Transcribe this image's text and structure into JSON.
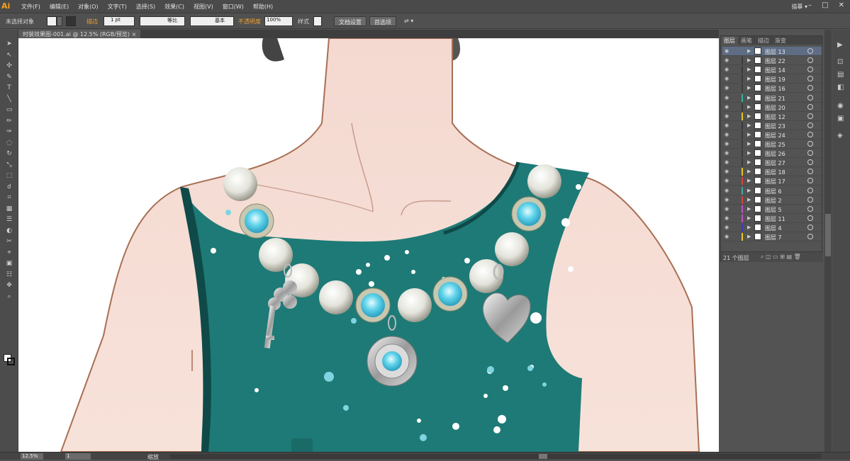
{
  "app": {
    "logo": "Ai",
    "workspace": "描摹 ▾"
  },
  "menu": [
    "文件(F)",
    "编辑(E)",
    "对象(O)",
    "文字(T)",
    "选择(S)",
    "效果(C)",
    "视图(V)",
    "窗口(W)",
    "帮助(H)"
  ],
  "control": {
    "selection": "未选择对象",
    "stroke_label": "描边",
    "stroke_weight": "1 pt",
    "profile": "等比",
    "brush": "基本",
    "opacity_label": "不透明度",
    "opacity_value": "100%",
    "style_label": "样式",
    "doc_setup": "文档设置",
    "prefs": "首选项"
  },
  "document": {
    "tab": "时装效果图-001.ai @ 12.5% (RGB/预览)"
  },
  "layers": {
    "tabs": [
      "图层",
      "画笔",
      "描边",
      "渐变"
    ],
    "rows": [
      {
        "name": "图层 13",
        "color": "#5e6d84",
        "selected": true
      },
      {
        "name": "图层 22",
        "color": "#3a3a3a"
      },
      {
        "name": "图层 14",
        "color": "#3a3a3a"
      },
      {
        "name": "图层 19",
        "color": "#3a3a3a"
      },
      {
        "name": "图层 16",
        "color": "#3a3a3a"
      },
      {
        "name": "图层 21",
        "color": "#2fb3a6"
      },
      {
        "name": "图层 20",
        "color": "#3a3a3a"
      },
      {
        "name": "图层 12",
        "color": "#e5c520"
      },
      {
        "name": "图层 23",
        "color": "#3a3a3a"
      },
      {
        "name": "图层 24",
        "color": "#3a3a3a"
      },
      {
        "name": "图层 25",
        "color": "#3a3a3a"
      },
      {
        "name": "图层 26",
        "color": "#3a3a3a"
      },
      {
        "name": "图层 27",
        "color": "#3a3a3a"
      },
      {
        "name": "图层 18",
        "color": "#e5c520"
      },
      {
        "name": "图层 17",
        "color": "#d94040"
      },
      {
        "name": "图层 6",
        "color": "#4aa3b0"
      },
      {
        "name": "图层 2",
        "color": "#d94040"
      },
      {
        "name": "图层 5",
        "color": "#c050c0"
      },
      {
        "name": "图层 11",
        "color": "#c050c0"
      },
      {
        "name": "图层 4",
        "color": "#3a3abf"
      },
      {
        "name": "图层 7",
        "color": "#e5c520"
      }
    ],
    "count": "21 个图层"
  },
  "status": {
    "zoom": "12.5%",
    "page": "1",
    "state": "缩放"
  }
}
